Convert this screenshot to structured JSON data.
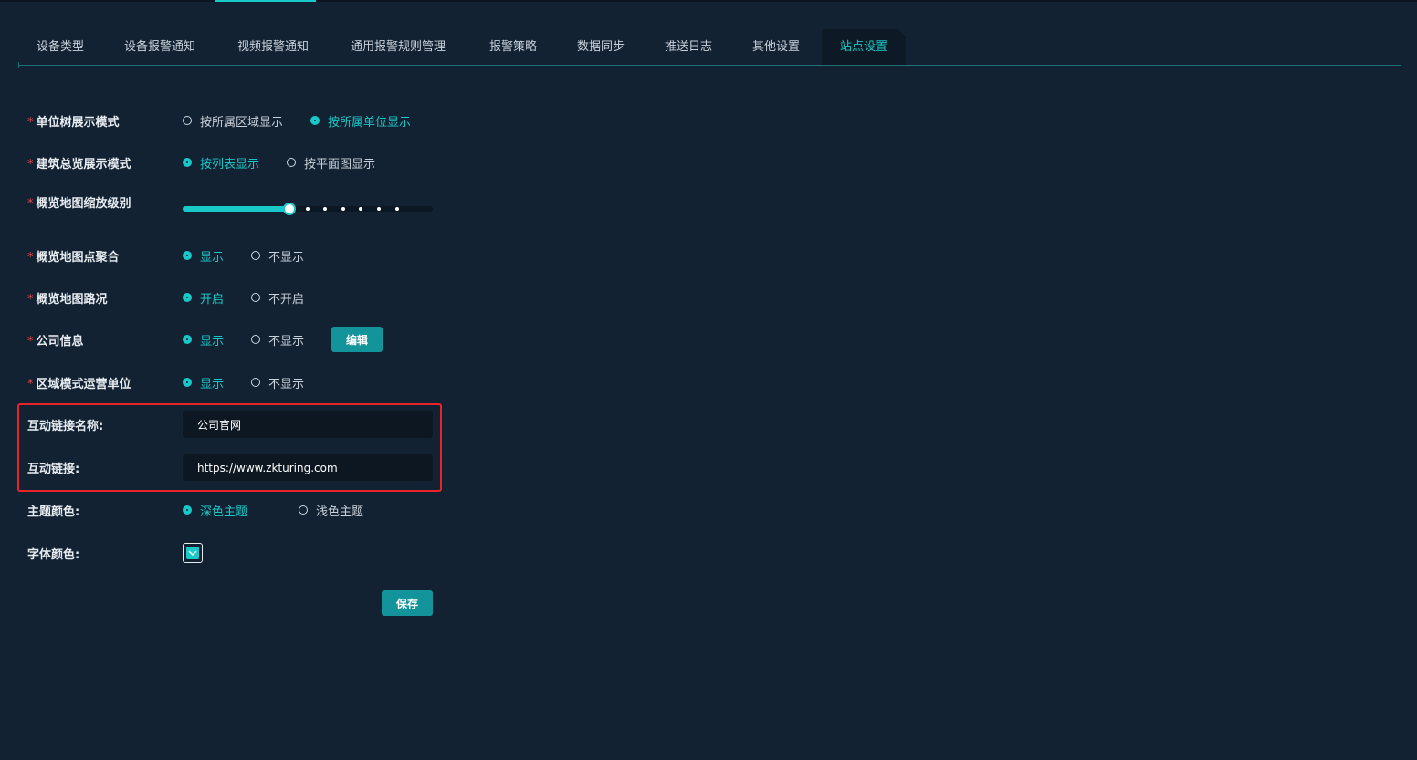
{
  "tabs": [
    {
      "label": "设备类型"
    },
    {
      "label": "设备报警通知"
    },
    {
      "label": "视频报警通知"
    },
    {
      "label": "通用报警规则管理"
    },
    {
      "label": "报警策略"
    },
    {
      "label": "数据同步"
    },
    {
      "label": "推送日志"
    },
    {
      "label": "其他设置"
    },
    {
      "label": "站点设置"
    }
  ],
  "active_tab": "站点设置",
  "form": {
    "unit_tree": {
      "required": "*",
      "label": "单位树展示模式",
      "options": [
        "按所属区域显示",
        "按所属单位显示"
      ],
      "selected": "按所属单位显示"
    },
    "building": {
      "required": "*",
      "label": "建筑总览展示模式",
      "options": [
        "按列表显示",
        "按平面图显示"
      ],
      "selected": "按列表显示"
    },
    "zoom": {
      "required": "*",
      "label": "概览地图缩放级别",
      "level": 7,
      "stops": 14
    },
    "cluster": {
      "required": "*",
      "label": "概览地图点聚合",
      "options": [
        "显示",
        "不显示"
      ],
      "selected": "显示"
    },
    "traffic": {
      "required": "*",
      "label": "概览地图路况",
      "options": [
        "开启",
        "不开启"
      ],
      "selected": "开启"
    },
    "company": {
      "required": "*",
      "label": "公司信息",
      "options": [
        "显示",
        "不显示"
      ],
      "selected": "显示",
      "edit_label": "编辑"
    },
    "region_op": {
      "required": "*",
      "label": "区域模式运营单位",
      "options": [
        "显示",
        "不显示"
      ],
      "selected": "显示"
    },
    "link_name": {
      "label": "互动链接名称:",
      "value": "公司官网"
    },
    "link_url": {
      "label": "互动链接:",
      "value": "https://www.zkturing.com"
    },
    "theme": {
      "label": "主题颜色:",
      "options": [
        "深色主题",
        "浅色主题"
      ],
      "selected": "深色主题"
    },
    "font_color": {
      "label": "字体颜色:",
      "value": "#19c8c8"
    }
  },
  "save_label": "保存",
  "colors": {
    "accent": "#19c8c8",
    "background": "#132233",
    "button": "#12949a",
    "highlight": "#e8232a"
  }
}
